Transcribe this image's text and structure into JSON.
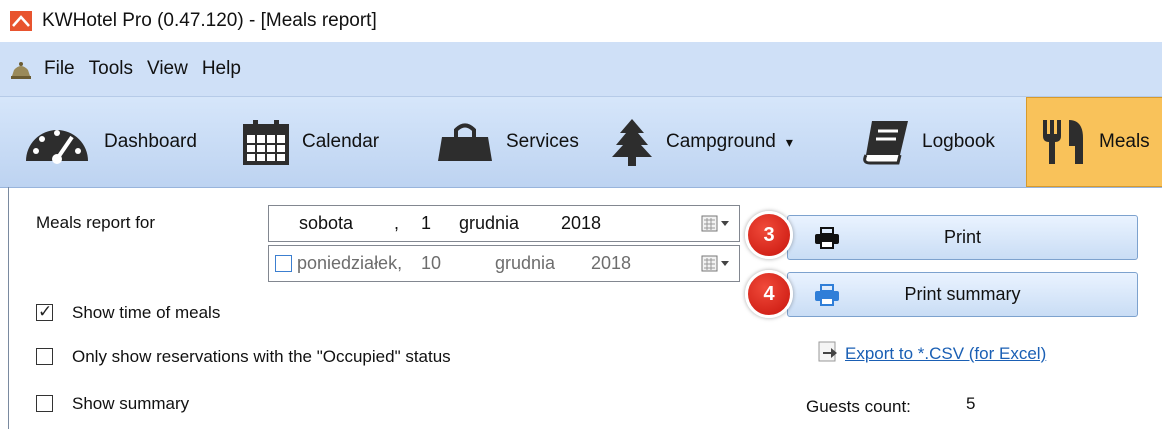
{
  "window": {
    "title": "KWHotel Pro (0.47.120) - [Meals report]",
    "icon": "app-logo-icon"
  },
  "menu": {
    "icon": "hotel-bell-icon",
    "items": [
      "File",
      "Tools",
      "View",
      "Help"
    ]
  },
  "toolbar": {
    "items": [
      {
        "label": "Dashboard",
        "icon": "speedometer-icon"
      },
      {
        "label": "Calendar",
        "icon": "calendar-icon"
      },
      {
        "label": "Services",
        "icon": "shopping-bag-icon"
      },
      {
        "label": "Campground",
        "icon": "tree-icon",
        "dropdown": "▾"
      },
      {
        "label": "Logbook",
        "icon": "book-icon"
      },
      {
        "label": "Meals",
        "icon": "fork-knife-icon",
        "active": true
      }
    ]
  },
  "report": {
    "for_label": "Meals report for",
    "date_from": {
      "weekday": "sobota",
      "comma": ",",
      "day": "1",
      "month": "grudnia",
      "year": "2018"
    },
    "date_to": {
      "weekday": "poniedziałek,",
      "day": "10",
      "month": "grudnia",
      "year": "2018",
      "enabled": false
    },
    "checkboxes": [
      {
        "label": "Show time of meals",
        "checked": true
      },
      {
        "label": "Only show reservations with the \"Occupied\" status",
        "checked": false
      },
      {
        "label": "Show summary",
        "checked": false
      }
    ],
    "print_button": "Print",
    "print_summary_button": "Print summary",
    "csv_link": "Export to *.CSV (for Excel)",
    "guests_label": "Guests count:",
    "guests_value": "5"
  },
  "badges": {
    "print": "3",
    "summary": "4"
  },
  "colors": {
    "toolbar_active": "#f9c25a",
    "menubar": "#cfe0f7",
    "badge": "#d9231a",
    "link": "#1a5fb4"
  }
}
